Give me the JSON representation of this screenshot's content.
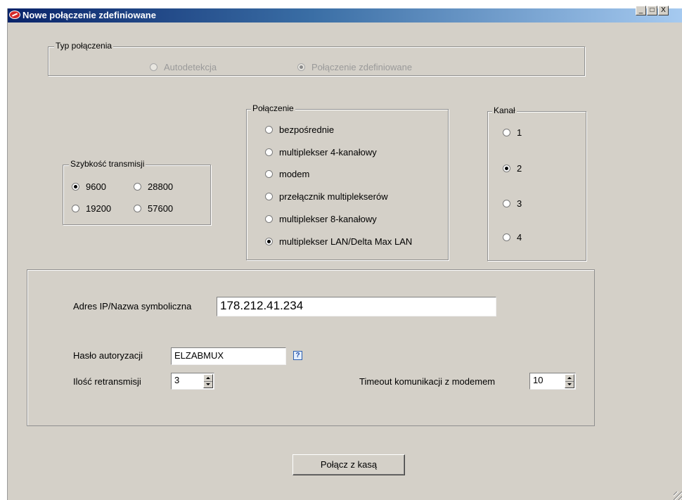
{
  "window": {
    "title": "Nowe połączenie zdefiniowane",
    "controls": {
      "minimize": "_",
      "maximize": "□",
      "close": "X"
    }
  },
  "connection_type": {
    "legend": "Typ połączenia",
    "options": [
      {
        "label": "Autodetekcja",
        "selected": false
      },
      {
        "label": "Połączenie zdefiniowane",
        "selected": true
      }
    ]
  },
  "speed": {
    "legend": "Szybkość transmisji",
    "options": [
      {
        "label": "9600",
        "selected": true
      },
      {
        "label": "28800",
        "selected": false
      },
      {
        "label": "19200",
        "selected": false
      },
      {
        "label": "57600",
        "selected": false
      }
    ]
  },
  "connection": {
    "legend": "Połączenie",
    "options": [
      {
        "label": "bezpośrednie",
        "selected": false
      },
      {
        "label": "multiplekser 4-kanałowy",
        "selected": false
      },
      {
        "label": "modem",
        "selected": false
      },
      {
        "label": "przełącznik multiplekserów",
        "selected": false
      },
      {
        "label": "multiplekser 8-kanałowy",
        "selected": false
      },
      {
        "label": "multiplekser LAN/Delta Max LAN",
        "selected": true
      }
    ]
  },
  "channel": {
    "legend": "Kanał",
    "options": [
      {
        "label": "1",
        "selected": false
      },
      {
        "label": "2",
        "selected": true
      },
      {
        "label": "3",
        "selected": false
      },
      {
        "label": "4",
        "selected": false
      }
    ]
  },
  "settings": {
    "ip_label": "Adres IP/Nazwa symboliczna",
    "ip_value": "178.212.41.234",
    "password_label": "Hasło autoryzacji",
    "password_value": "ELZABMUX",
    "help_icon": "?",
    "retransmissions_label": "Ilość retransmisji",
    "retransmissions_value": "3",
    "timeout_label": "Timeout komunikacji z modemem",
    "timeout_value": "10"
  },
  "connect_button": "Połącz z kasą",
  "colors": {
    "window_bg": "#d4d0c8",
    "titlebar": "#0a246a"
  }
}
